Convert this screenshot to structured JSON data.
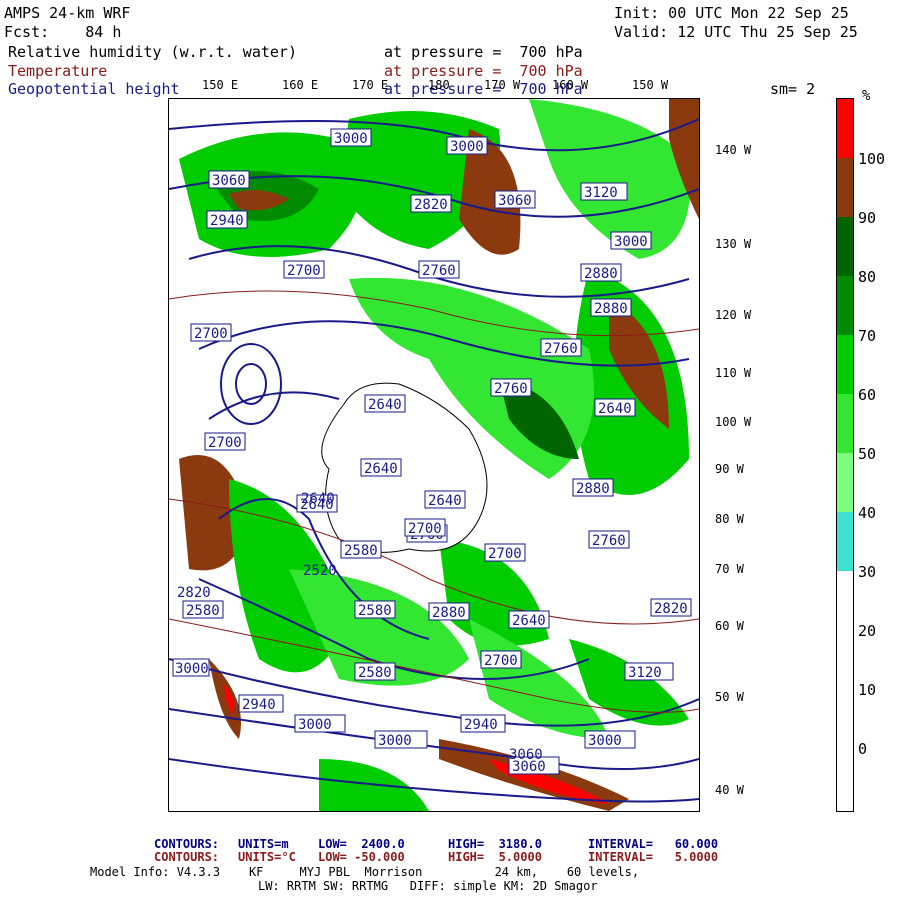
{
  "header": {
    "model": "AMPS 24-km WRF",
    "fcst": "Fcst:    84 h",
    "init": "Init: 00 UTC Mon 22 Sep 25",
    "valid": "Valid: 12 UTC Thu 25 Sep 25"
  },
  "fields": [
    {
      "name": "Relative humidity (w.r.t. water)",
      "level": "at pressure =  700 hPa",
      "color": "#000000"
    },
    {
      "name": "Temperature",
      "level": "at pressure =  700 hPa",
      "color": "#8b1a1a"
    },
    {
      "name": "Geopotential height",
      "level": "at pressure =  700 hPa",
      "color": "#1a1a8b"
    }
  ],
  "smoothing": "sm= 2",
  "top_lon_labels": [
    "150 E",
    "160 E",
    "170 E",
    "180",
    "170 W",
    "160 W",
    "150 W"
  ],
  "right_lon_labels": [
    "140 W",
    "130 W",
    "120 W",
    "110 W",
    "100 W",
    "90 W",
    "80 W",
    "70 W",
    "60 W",
    "50 W",
    "40 W"
  ],
  "contour_labels": [
    "3000",
    "3000",
    "3060",
    "3120",
    "2820",
    "3060",
    "2940",
    "2880",
    "3000",
    "2700",
    "2760",
    "2880",
    "2760",
    "2700",
    "2640",
    "2760",
    "2640",
    "2580",
    "2640",
    "2760",
    "2700",
    "2640",
    "2580",
    "2580",
    "2700",
    "2640",
    "2700",
    "2760",
    "2820",
    "3000",
    "3060",
    "3120",
    "2940",
    "2940",
    "3000",
    "3000",
    "3060",
    "3000",
    "2880",
    "2820",
    "2580",
    "2520",
    "2880",
    "2640",
    "2700",
    "2640"
  ],
  "colorbar": {
    "unit": "%",
    "ticks": [
      "100",
      "90",
      "80",
      "70",
      "60",
      "50",
      "40",
      "30",
      "20",
      "10",
      "0"
    ],
    "segments": [
      {
        "range": "100+",
        "color": "#ff0000"
      },
      {
        "range": "90-100",
        "color": "#8b3a0f"
      },
      {
        "range": "80-90",
        "color": "#006400"
      },
      {
        "range": "70-80",
        "color": "#008b00"
      },
      {
        "range": "60-70",
        "color": "#00cc00"
      },
      {
        "range": "50-60",
        "color": "#32e632"
      },
      {
        "range": "40-50",
        "color": "#7fff7f"
      },
      {
        "range": "30-40",
        "color": "#40e0d0"
      },
      {
        "range": "0-30",
        "color": "#ffffff"
      }
    ]
  },
  "footer": {
    "line1": {
      "label": "CONTOURS:",
      "units": "UNITS=m",
      "low": "LOW=  2400.0",
      "high": "HIGH=  3180.0",
      "interval": "INTERVAL=   60.000"
    },
    "line2": {
      "label": "CONTOURS:",
      "units": "UNITS=°C",
      "low": "LOW= -50.000",
      "high": "HIGH=  5.0000",
      "interval": "INTERVAL=   5.0000"
    },
    "line3": "Model Info: V4.3.3    KF     MYJ PBL  Morrison          24 km,    60 levels,",
    "line4": "LW: RRTM SW: RRTMG   DIFF: simple KM: 2D Smagor"
  }
}
